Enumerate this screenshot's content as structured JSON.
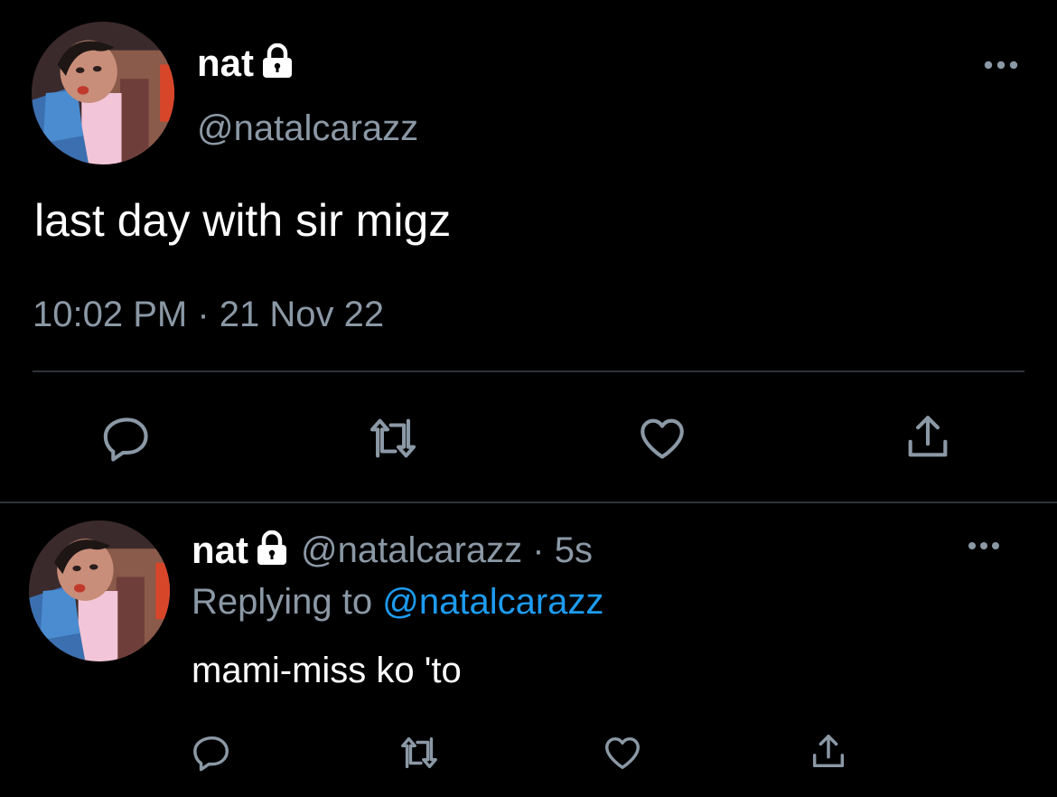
{
  "main_tweet": {
    "name": "nat",
    "handle": "@natalcarazz",
    "text": "last day with sir migz",
    "timestamp": "10:02 PM · 21 Nov 22",
    "avatar_icon": "profile-photo",
    "lock_icon": "lock-icon",
    "more_icon": "more-options-icon",
    "actions": [
      "reply-icon",
      "retweet-icon",
      "like-icon",
      "share-icon"
    ]
  },
  "reply_tweet": {
    "name": "nat",
    "handle_time": "@natalcarazz · 5s",
    "replying_prefix": "Replying to ",
    "replying_mention": "@natalcarazz",
    "text": "mami-miss ko 'to",
    "more_icon": "more-options-icon",
    "actions": [
      "reply-icon",
      "retweet-icon",
      "like-icon",
      "share-icon"
    ]
  },
  "colors": {
    "background": "#000000",
    "primary_text": "#ffffff",
    "secondary_text": "#8b98a5",
    "link": "#1d9bf0",
    "divider": "#2f3336"
  }
}
